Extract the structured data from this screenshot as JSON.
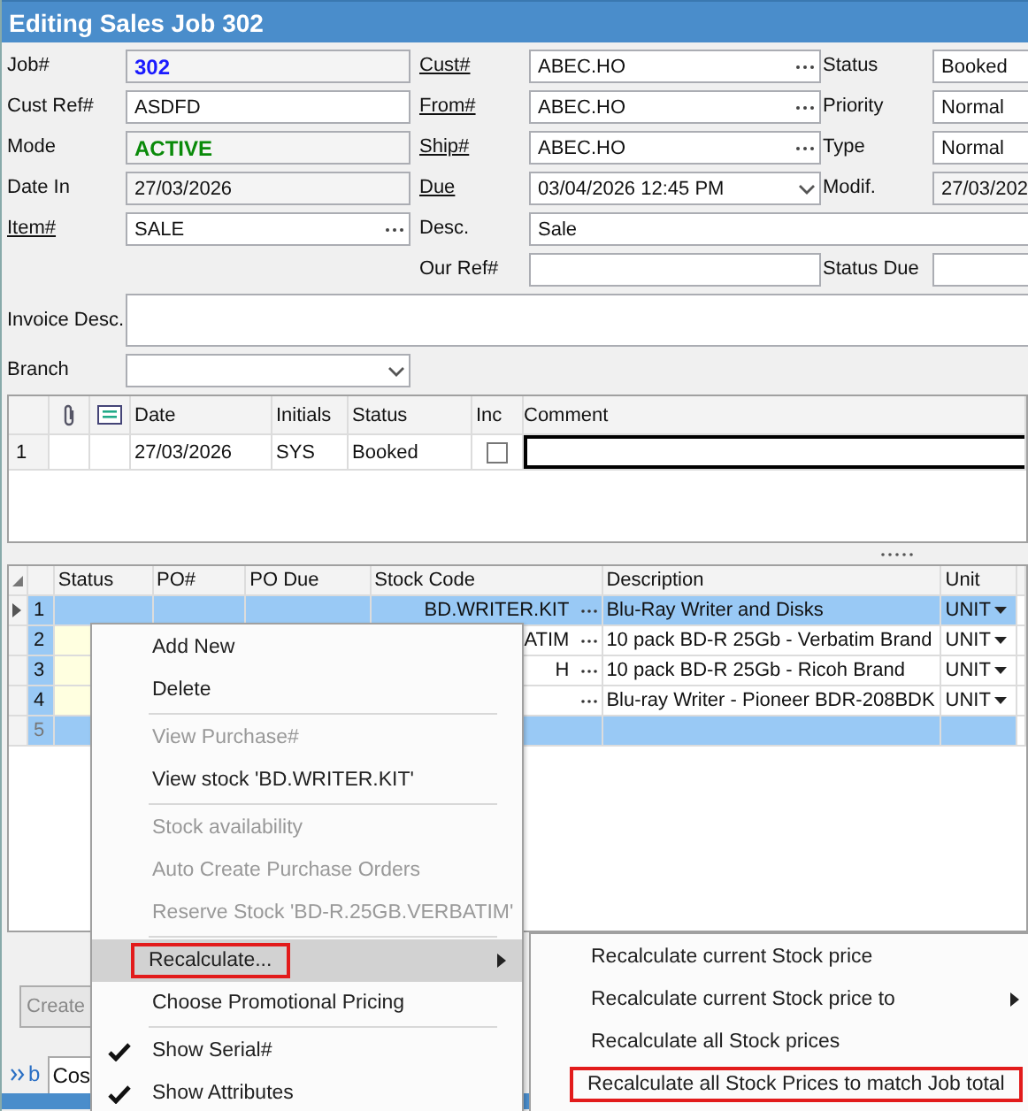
{
  "window": {
    "title": "Editing Sales Job 302"
  },
  "form": {
    "rows": [
      {
        "left": {
          "label": "Job#",
          "value": "302",
          "kind": "id",
          "link": false
        },
        "middle": {
          "label": "Cust#",
          "value": "ABEC.HO",
          "kind": "lookup",
          "link": true
        },
        "right": {
          "label": "Status",
          "value": "Booked",
          "kind": "text",
          "link": false
        }
      },
      {
        "left": {
          "label": "Cust Ref#",
          "value": "ASDFD",
          "kind": "text",
          "link": false
        },
        "middle": {
          "label": "From#",
          "value": "ABEC.HO",
          "kind": "lookup",
          "link": true
        },
        "right": {
          "label": "Priority",
          "value": "Normal",
          "kind": "text",
          "link": false
        }
      },
      {
        "left": {
          "label": "Mode",
          "value": "ACTIVE",
          "kind": "mode",
          "link": false
        },
        "middle": {
          "label": "Ship#",
          "value": "ABEC.HO",
          "kind": "lookup",
          "link": true
        },
        "right": {
          "label": "Type",
          "value": "Normal",
          "kind": "text",
          "link": false
        }
      },
      {
        "left": {
          "label": "Date In",
          "value": "27/03/2026",
          "kind": "readonly",
          "link": false
        },
        "middle": {
          "label": "Due",
          "value": "03/04/2026 12:45 PM",
          "kind": "dropdown",
          "link": true
        },
        "right": {
          "label": "Modif.",
          "value": "27/03/202",
          "kind": "readonly",
          "link": false
        }
      },
      {
        "left": {
          "label": "Item#",
          "value": "SALE",
          "kind": "lookup",
          "link": true
        },
        "middle": {
          "label": "Desc.",
          "value": "Sale",
          "kind": "wide",
          "link": false
        }
      },
      {
        "middle": {
          "label": "Our Ref#",
          "kind": "text",
          "link": false
        },
        "right": {
          "label": "Status Due",
          "kind": "text",
          "link": false
        }
      },
      {
        "left": {
          "label": "Invoice Desc.",
          "kind": "memo",
          "link": false
        }
      },
      {
        "left": {
          "label": "Branch",
          "kind": "dropdown",
          "link": false
        }
      }
    ]
  },
  "notes": {
    "columns": [
      "Date",
      "Initials",
      "Status",
      "Inc",
      "Comment"
    ],
    "rows": [
      {
        "number": "1",
        "date": "27/03/2026",
        "initials": "SYS",
        "status": "Booked",
        "inc": false
      }
    ]
  },
  "items": {
    "columns": [
      "Status",
      "PO#",
      "PO Due",
      "Stock Code",
      "Description",
      "Unit"
    ],
    "rows": [
      {
        "number": "1",
        "kind": "item",
        "selected": true,
        "stock_code": "BD.WRITER.KIT",
        "description": "Blu-Ray Writer and Disks",
        "unit": "UNIT"
      },
      {
        "number": "2",
        "kind": "item",
        "selected": false,
        "stock_code": "ATIM",
        "description": "10 pack BD-R 25Gb - Verbatim Brand",
        "unit": "UNIT"
      },
      {
        "number": "3",
        "kind": "item",
        "selected": false,
        "stock_code": "H",
        "description": "10 pack BD-R 25Gb - Ricoh Brand",
        "unit": "UNIT"
      },
      {
        "number": "4",
        "kind": "item",
        "selected": false,
        "description": "Blu-ray Writer - Pioneer BDR-208BDK",
        "unit": "UNIT"
      },
      {
        "number": "5",
        "kind": "new",
        "selected": true
      }
    ]
  },
  "bottom": {
    "button": "Create",
    "tabs": [
      {
        "label": "b",
        "kind": "link",
        "selected": false
      },
      {
        "label": "Cos",
        "kind": "tab",
        "selected": true
      }
    ]
  },
  "context_menu": {
    "items": [
      {
        "kind": "item",
        "label": "Add New",
        "disabled": false,
        "checked": false,
        "highlighted": false,
        "outlined": false,
        "submenu": false
      },
      {
        "kind": "item",
        "label": "Delete",
        "disabled": false,
        "checked": false,
        "highlighted": false,
        "outlined": false,
        "submenu": false
      },
      {
        "kind": "separator"
      },
      {
        "kind": "item",
        "label": "View Purchase#",
        "disabled": true,
        "checked": false,
        "highlighted": false,
        "outlined": false,
        "submenu": false
      },
      {
        "kind": "item",
        "label": "View stock 'BD.WRITER.KIT'",
        "disabled": false,
        "checked": false,
        "highlighted": false,
        "outlined": false,
        "submenu": false
      },
      {
        "kind": "separator"
      },
      {
        "kind": "item",
        "label": "Stock availability",
        "disabled": true,
        "checked": false,
        "highlighted": false,
        "outlined": false,
        "submenu": false
      },
      {
        "kind": "item",
        "label": "Auto Create Purchase Orders",
        "disabled": true,
        "checked": false,
        "highlighted": false,
        "outlined": false,
        "submenu": false
      },
      {
        "kind": "item",
        "label": "Reserve Stock 'BD-R.25GB.VERBATIM'",
        "disabled": true,
        "checked": false,
        "highlighted": false,
        "outlined": false,
        "submenu": false
      },
      {
        "kind": "separator"
      },
      {
        "kind": "item",
        "label": "Recalculate...",
        "disabled": false,
        "checked": false,
        "highlighted": true,
        "outlined": true,
        "submenu": true
      },
      {
        "kind": "item",
        "label": "Choose Promotional Pricing",
        "disabled": false,
        "checked": false,
        "highlighted": false,
        "outlined": false,
        "submenu": false
      },
      {
        "kind": "separator"
      },
      {
        "kind": "item",
        "label": "Show Serial#",
        "disabled": false,
        "checked": true,
        "highlighted": false,
        "outlined": false,
        "submenu": false
      },
      {
        "kind": "item",
        "label": "Show Attributes",
        "disabled": false,
        "checked": true,
        "highlighted": false,
        "outlined": false,
        "submenu": false
      }
    ]
  },
  "submenu": {
    "items": [
      {
        "label": "Recalculate current Stock price",
        "outlined": false,
        "submenu": false
      },
      {
        "label": "Recalculate current Stock price to",
        "outlined": false,
        "submenu": true
      },
      {
        "label": "Recalculate all Stock prices",
        "outlined": false,
        "submenu": false
      },
      {
        "label": "Recalculate all Stock Prices to match Job total",
        "outlined": true,
        "submenu": false
      }
    ]
  }
}
